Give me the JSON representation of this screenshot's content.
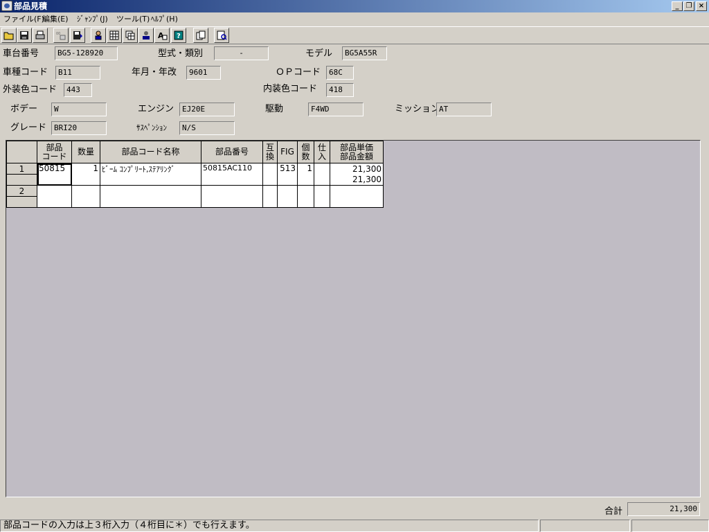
{
  "window": {
    "title": "部品見積"
  },
  "menu": [
    "ファイル(F)",
    "編集(E)",
    "ｼﾞｬﾝﾌﾟ(J)",
    "ツール(T)",
    "ﾍﾙﾌﾟ(H)"
  ],
  "toolbar_icons": [
    "open-folder-icon",
    "save-disk-icon",
    "print-icon",
    "copy-data-icon",
    "save-alt-icon",
    "user-icon",
    "grid-icon",
    "table-icon",
    "search-person-icon",
    "font-icon",
    "help-icon",
    "pages-icon",
    "preview-icon"
  ],
  "form": {
    "chassis_no_label": "車台番号",
    "chassis_no": "BG5-128920",
    "model_type_label": "型式・類別",
    "model_type": "-",
    "model_label": "モデル",
    "model": "BG5A55R",
    "car_code_label": "車種コード",
    "car_code": "B11",
    "year_label": "年月・年改",
    "year": "9601",
    "op_code_label": "ＯＰコード",
    "op_code": "68C",
    "ext_color_label": "外装色コード",
    "ext_color": "443",
    "int_color_label": "内装色コード",
    "int_color": "418",
    "body_label": "ボデー",
    "body": "W",
    "engine_label": "エンジン",
    "engine": "EJ20E",
    "drive_label": "駆動",
    "drive": "F4WD",
    "mission_label": "ミッション",
    "mission": "AT",
    "grade_label": "グレード",
    "grade": "BRI20",
    "suspension_label": "ｻｽﾍﾟﾝｼｮﾝ",
    "suspension": "N/S"
  },
  "grid": {
    "headers": {
      "part_code_1": "部品",
      "part_code_2": "コード",
      "qty": "数量",
      "part_name": "部品コード名称",
      "part_no": "部品番号",
      "interchange_1": "互",
      "interchange_2": "換",
      "fig": "FIG",
      "count_1": "個",
      "count_2": "数",
      "purchase_1": "仕",
      "purchase_2": "入",
      "price_1": "部品単価",
      "price_2": "部品金額"
    },
    "rows": [
      {
        "no": "1",
        "part_code": "50815",
        "qty": "1",
        "part_name": "ﾋﾞｰﾑ ｺﾝﾌﾟﾘｰﾄ,ｽﾃｱﾘﾝｸﾞ",
        "part_no": "50815AC110",
        "interchange": "",
        "fig": "513",
        "count": "1",
        "purchase": "",
        "unit_price": "21,300",
        "amount": "21,300"
      },
      {
        "no": "2",
        "part_code": "",
        "qty": "",
        "part_name": "",
        "part_no": "",
        "interchange": "",
        "fig": "",
        "count": "",
        "purchase": "",
        "unit_price": "",
        "amount": ""
      }
    ]
  },
  "total": {
    "label": "合計",
    "value": "21,300"
  },
  "status": {
    "message": "部品コードの入力は上３桁入力（４桁目に＊）でも行えます。"
  }
}
